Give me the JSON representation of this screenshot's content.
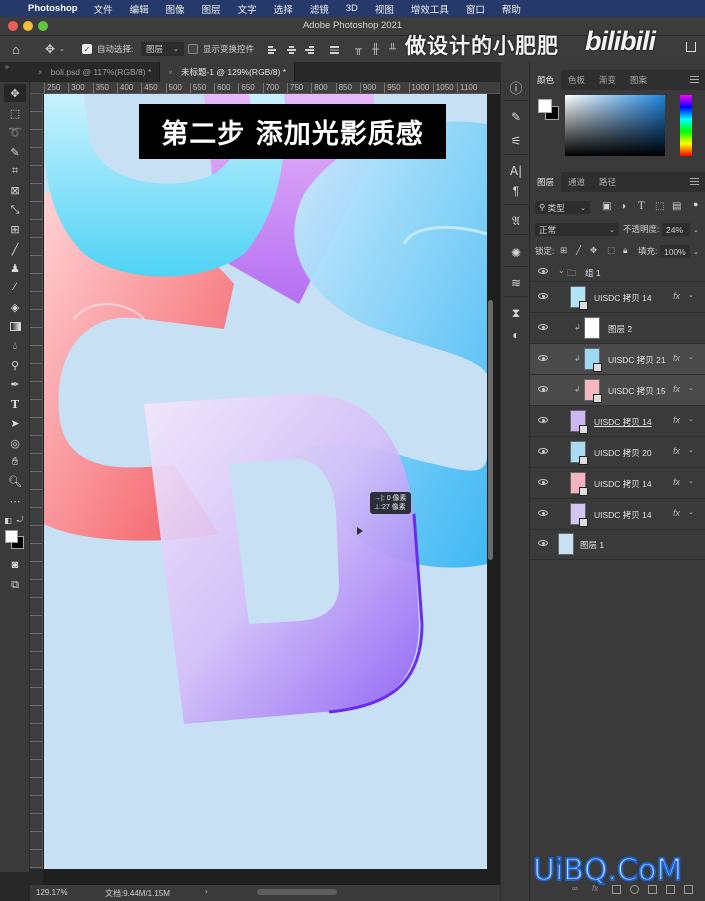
{
  "menubar": {
    "app": "Photoshop",
    "items": [
      "文件",
      "编辑",
      "图像",
      "图层",
      "文字",
      "选择",
      "滤镜",
      "3D",
      "视图",
      "增效工具",
      "窗口",
      "帮助"
    ]
  },
  "window": {
    "title": "Adobe Photoshop 2021"
  },
  "options_bar": {
    "auto_select_label": "自动选择:",
    "auto_select_checked": true,
    "auto_select_target": "图层",
    "show_transform_label": "显示变换控件",
    "show_transform_checked": false
  },
  "watermark": {
    "author": "做设计的小肥肥",
    "site": "bilibili",
    "corner": "UiBQ.CoM"
  },
  "doc_tabs": [
    {
      "label": "boli.psd @ 117%(RGB/8) *",
      "active": false
    },
    {
      "label": "未标题-1 @ 129%(RGB/8) *",
      "active": true
    }
  ],
  "ruler_top": [
    "250",
    "300",
    "350",
    "400",
    "450",
    "500",
    "550",
    "600",
    "650",
    "700",
    "750",
    "800",
    "850",
    "900",
    "950",
    "1000",
    "1050",
    "1100"
  ],
  "canvas": {
    "banner": "第二步 添加光影质感",
    "measure_tooltip": {
      "dx": "→|: 0 像素",
      "dy": "⊥:27 像素"
    },
    "background_color": "#c8e0f4"
  },
  "status": {
    "zoom": "129.17%",
    "doc_size": "文档:9.44M/1.15M",
    "arrow": "›"
  },
  "tools": [
    "move-tool",
    "marquee-tool",
    "lasso-tool",
    "quick-select-tool",
    "crop-tool",
    "frame-tool",
    "eyedropper-tool",
    "healing-brush-tool",
    "brush-tool",
    "clone-stamp-tool",
    "history-brush-tool",
    "eraser-tool",
    "gradient-tool",
    "blur-tool",
    "dodge-tool",
    "pen-tool",
    "type-tool",
    "path-select-tool",
    "ellipse-tool",
    "hand-tool",
    "zoom-tool",
    "more-tools"
  ],
  "panels": {
    "color_tabs": [
      "颜色",
      "色板",
      "渐变",
      "图案"
    ],
    "layer_tabs": [
      "图层",
      "通道",
      "路径"
    ],
    "filter_kind": "类型",
    "blend_mode": "正常",
    "opacity_label": "不透明度:",
    "opacity_value": "24%",
    "lock_label": "锁定:",
    "fill_label": "填充:",
    "fill_value": "100%",
    "group_name": "组 1",
    "layers": [
      {
        "name": "UISDC 拷贝 14",
        "fx": "fx",
        "clipped": false,
        "selected": false,
        "thumb": "#aee4f8"
      },
      {
        "name": "图层 2",
        "fx": "",
        "clipped": true,
        "selected": false,
        "thumb": "#ffffff"
      },
      {
        "name": "UISDC 拷贝 21",
        "fx": "fx",
        "clipped": true,
        "selected": true,
        "thumb": "#9fd8f5"
      },
      {
        "name": "UISDC 拷贝 15",
        "fx": "fx",
        "clipped": true,
        "selected": true,
        "thumb": "#f6b8c0"
      },
      {
        "name": "UISDC 拷贝 14",
        "fx": "fx",
        "clipped": false,
        "selected": false,
        "thumb": "#cdb6f5",
        "underlined": true
      },
      {
        "name": "UISDC 拷贝 20",
        "fx": "fx",
        "clipped": false,
        "selected": false,
        "thumb": "#a8dcf4"
      },
      {
        "name": "UISDC 拷贝 14",
        "fx": "fx",
        "clipped": false,
        "selected": false,
        "thumb": "#f5b4bd"
      },
      {
        "name": "UISDC 拷贝 14",
        "fx": "fx",
        "clipped": false,
        "selected": false,
        "thumb": "#d6c4f5"
      }
    ],
    "background_layer": {
      "name": "图层 1",
      "thumb": "#c8e0f4"
    }
  }
}
